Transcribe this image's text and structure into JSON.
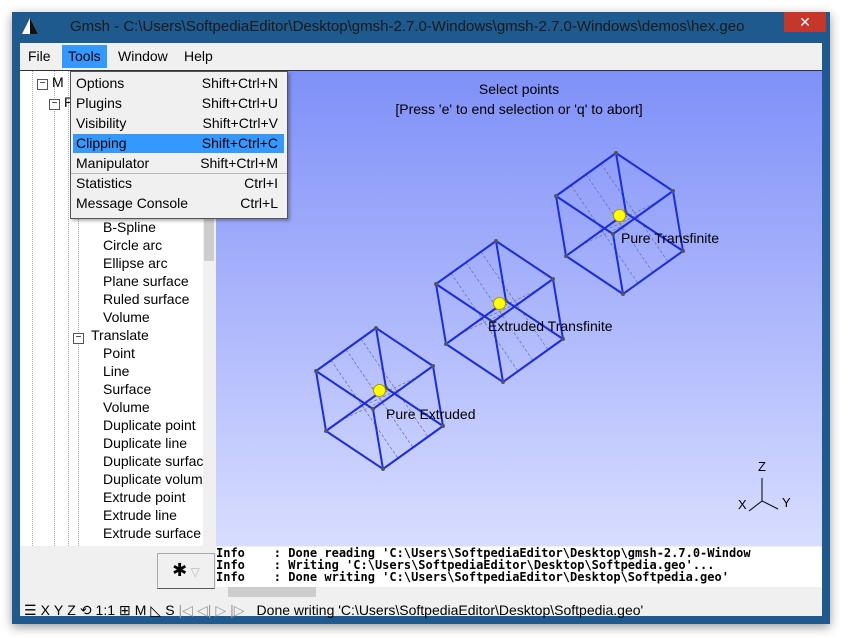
{
  "window": {
    "title": "Gmsh - C:\\Users\\SoftpediaEditor\\Desktop\\gmsh-2.7.0-Windows\\gmsh-2.7.0-Windows\\demos\\hex.geo",
    "close": "✕"
  },
  "menubar": [
    "File",
    "Tools",
    "Window",
    "Help"
  ],
  "tools_menu": [
    {
      "label": "Options",
      "shortcut": "Shift+Ctrl+N"
    },
    {
      "label": "Plugins",
      "shortcut": "Shift+Ctrl+U"
    },
    {
      "label": "Visibility",
      "shortcut": "Shift+Ctrl+V"
    },
    {
      "label": "Clipping",
      "shortcut": "Shift+Ctrl+C",
      "highlighted": true
    },
    {
      "label": "Manipulator",
      "shortcut": "Shift+Ctrl+M"
    },
    {
      "label": "Statistics",
      "shortcut": "Ctrl+I"
    },
    {
      "label": "Message Console",
      "shortcut": "Ctrl+L"
    }
  ],
  "tree": {
    "top": [
      "M",
      "P"
    ],
    "items1": [
      "B-Spline",
      "Circle arc",
      "Ellipse arc",
      "Plane surface",
      "Ruled surface",
      "Volume"
    ],
    "translate": "Translate",
    "items2": [
      "Point",
      "Line",
      "Surface",
      "Volume",
      "Duplicate point",
      "Duplicate line",
      "Duplicate surfac",
      "Duplicate volum",
      "Extrude point",
      "Extrude line",
      "Extrude surface"
    ]
  },
  "graphics": {
    "prompt1": "Select points",
    "prompt2": "[Press 'e' to end selection or 'q' to abort]",
    "labels": [
      "Pure Extruded",
      "Extruded Transfinite",
      "Pure Transfinite"
    ],
    "axes": {
      "z": "Z",
      "x": "X",
      "y": "Y"
    },
    "edge_color": "#1a2be0",
    "point_color": "#ffff00"
  },
  "messages": [
    "Info    : Done reading 'C:\\Users\\SoftpediaEditor\\Desktop\\gmsh-2.7.0-Window",
    "Info    : Writing 'C:\\Users\\SoftpediaEditor\\Desktop\\Softpedia.geo'...",
    "Info    : Done writing 'C:\\Users\\SoftpediaEditor\\Desktop\\Softpedia.geo'"
  ],
  "status": {
    "buttons": [
      "☰",
      "X",
      "Y",
      "Z",
      "⟲",
      "1:1",
      "⊞",
      "M",
      "◺",
      "S",
      "|◁",
      "◁|",
      "▷",
      "|▷"
    ],
    "text": "Done writing 'C:\\Users\\SoftpediaEditor\\Desktop\\Softpedia.geo'"
  },
  "gear": "✱"
}
